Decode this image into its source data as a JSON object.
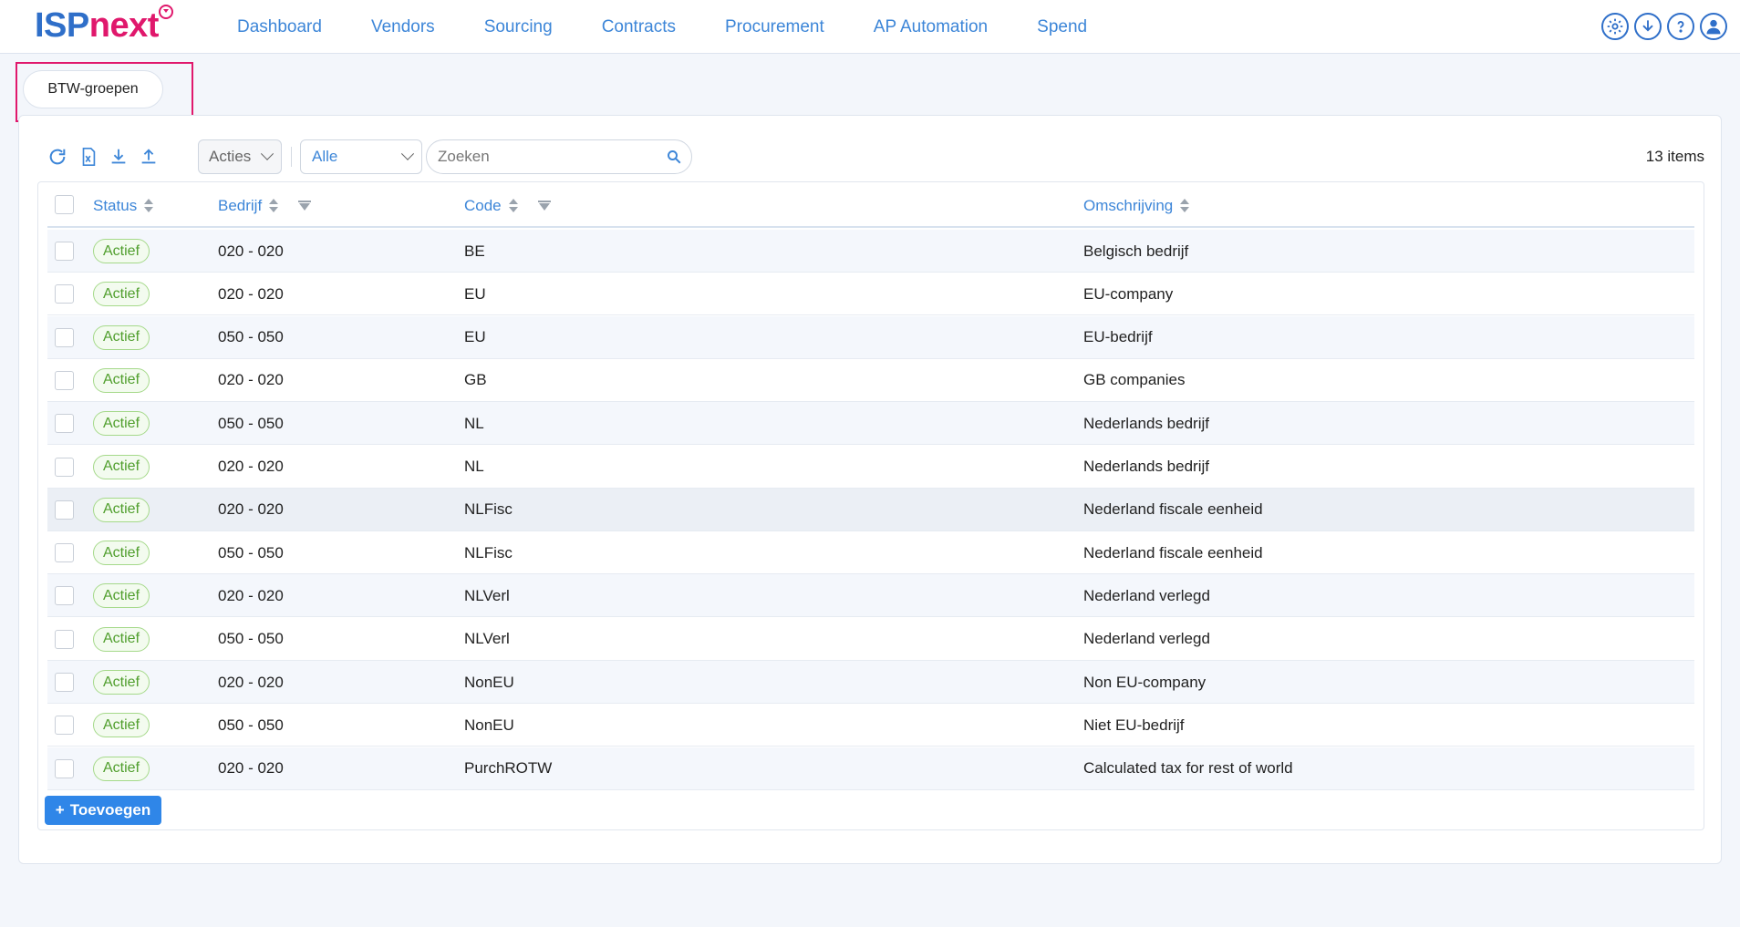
{
  "brand": {
    "part1": "ISP",
    "part2": "next"
  },
  "nav": [
    "Dashboard",
    "Vendors",
    "Sourcing",
    "Contracts",
    "Procurement",
    "AP Automation",
    "Spend"
  ],
  "top_icons": [
    "settings-icon",
    "download-icon",
    "help-icon",
    "user-icon"
  ],
  "page_tab": "BTW-groepen",
  "toolbar": {
    "acties_label": "Acties",
    "filter_value": "Alle",
    "search_placeholder": "Zoeken",
    "item_count": "13 items",
    "icons": [
      "refresh-icon",
      "excel-export-icon",
      "download-icon",
      "upload-icon"
    ]
  },
  "table": {
    "columns": [
      "Status",
      "Bedrijf",
      "Code",
      "Omschrijving"
    ],
    "rows": [
      {
        "status": "Actief",
        "bedrijf": "020 - 020",
        "code": "BE",
        "omschrijving": "Belgisch bedrijf"
      },
      {
        "status": "Actief",
        "bedrijf": "020 - 020",
        "code": "EU",
        "omschrijving": "EU-company"
      },
      {
        "status": "Actief",
        "bedrijf": "050 - 050",
        "code": "EU",
        "omschrijving": "EU-bedrijf"
      },
      {
        "status": "Actief",
        "bedrijf": "020 - 020",
        "code": "GB",
        "omschrijving": "GB companies"
      },
      {
        "status": "Actief",
        "bedrijf": "050 - 050",
        "code": "NL",
        "omschrijving": "Nederlands bedrijf"
      },
      {
        "status": "Actief",
        "bedrijf": "020 - 020",
        "code": "NL",
        "omschrijving": "Nederlands bedrijf"
      },
      {
        "status": "Actief",
        "bedrijf": "020 - 020",
        "code": "NLFisc",
        "omschrijving": "Nederland fiscale eenheid"
      },
      {
        "status": "Actief",
        "bedrijf": "050 - 050",
        "code": "NLFisc",
        "omschrijving": "Nederland fiscale eenheid"
      },
      {
        "status": "Actief",
        "bedrijf": "020 - 020",
        "code": "NLVerl",
        "omschrijving": "Nederland verlegd"
      },
      {
        "status": "Actief",
        "bedrijf": "050 - 050",
        "code": "NLVerl",
        "omschrijving": "Nederland verlegd"
      },
      {
        "status": "Actief",
        "bedrijf": "020 - 020",
        "code": "NonEU",
        "omschrijving": "Non EU-company"
      },
      {
        "status": "Actief",
        "bedrijf": "050 - 050",
        "code": "NonEU",
        "omschrijving": "Niet EU-bedrijf"
      },
      {
        "status": "Actief",
        "bedrijf": "020 - 020",
        "code": "PurchROTW",
        "omschrijving": "Calculated tax for rest of world"
      }
    ]
  },
  "add_button": {
    "icon": "+",
    "label": "Toevoegen"
  },
  "colors": {
    "primary": "#3d86d8",
    "brand_pink": "#e0186c",
    "badge_green": "#4f9e2c",
    "button_blue": "#2f86e8"
  }
}
